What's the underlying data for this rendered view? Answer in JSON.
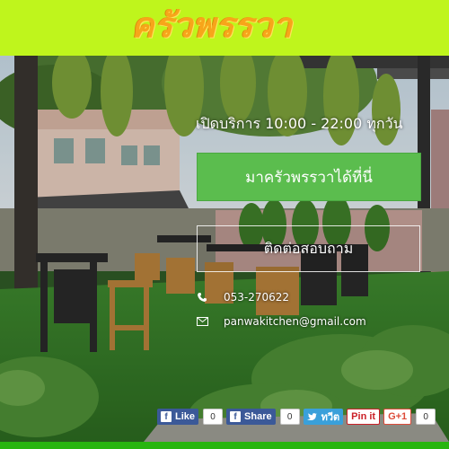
{
  "header": {
    "brand_name": "ครัวพรรวา",
    "background_color": "#bff51c",
    "brand_color": "#f7a51a"
  },
  "hero": {
    "opening_hours": "เปิดบริการ 10:00 - 22:00 ทุกวัน",
    "cta_label": "มาครัวพรรวาได้ที่นี่",
    "contact_label": "ติดต่อสอบถาม",
    "phone": "053-270622",
    "email": "panwakitchen@gmail.com",
    "cta_color": "#5bbd4e"
  },
  "share": {
    "facebook_like_label": "Like",
    "facebook_like_count": "0",
    "facebook_share_label": "Share",
    "facebook_share_count": "0",
    "twitter_label": "ทวีต",
    "pinterest_label": "Pin it",
    "gplus_label": "G+1",
    "gplus_count": "0"
  },
  "icons": {
    "phone": "phone-icon",
    "email": "envelope-icon",
    "facebook": "facebook-icon",
    "twitter": "twitter-bird-icon"
  },
  "footer": {
    "bar_color": "#27b50f"
  }
}
